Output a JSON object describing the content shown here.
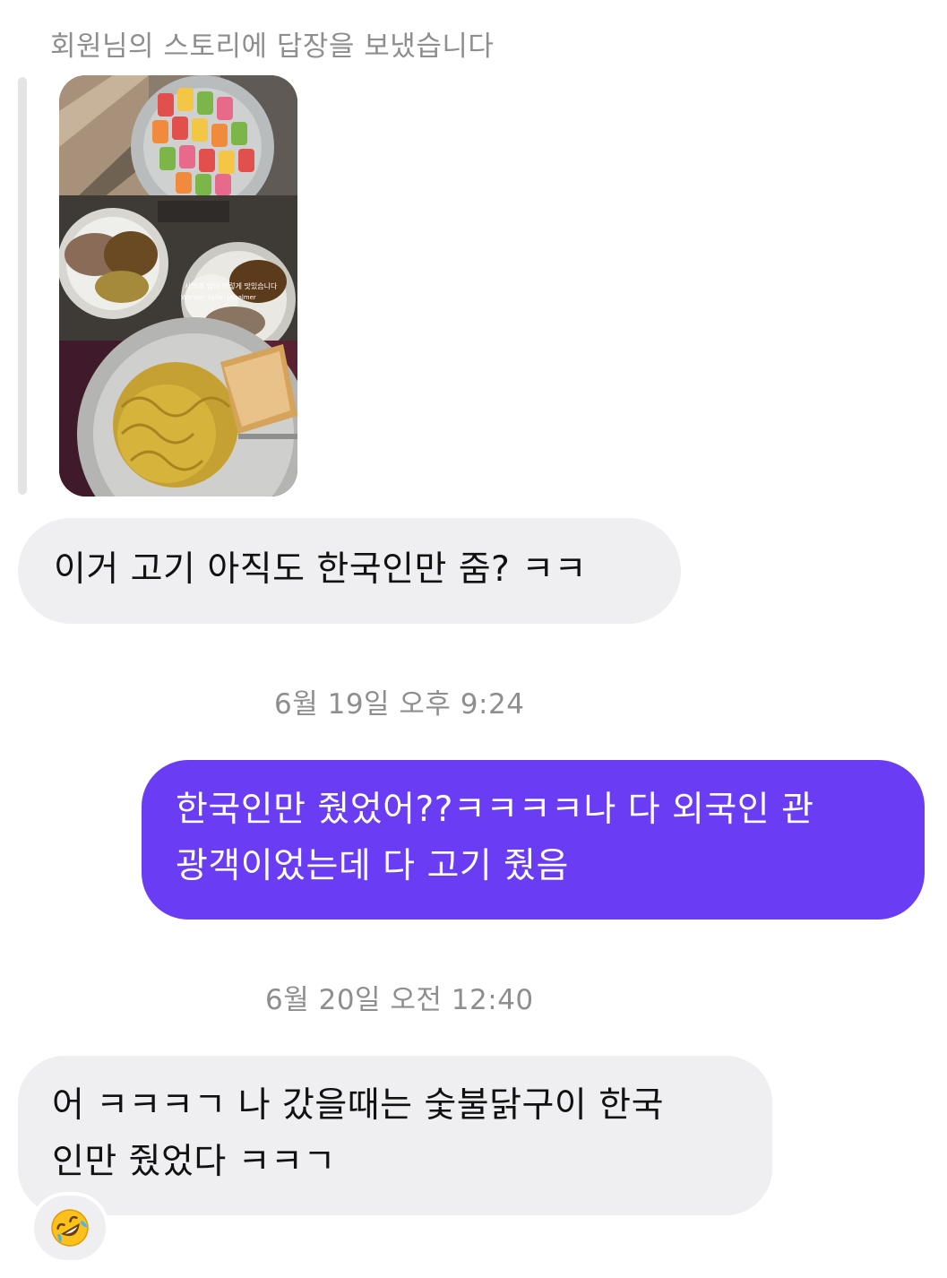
{
  "story_reply": {
    "label": "회원님의 스토리에 답장을 보냈습니다",
    "photo_caption": "사막의 밤이 이렇게 맛있습니다",
    "photo_location": "Wonder Safari Jaisalmer"
  },
  "messages": [
    {
      "sender": "them",
      "lines": [
        "이거 고기 아직도 한국인만 줌? ㅋㅋ"
      ]
    },
    {
      "timestamp": "6월 19일 오후 9:24"
    },
    {
      "sender": "me",
      "lines": [
        "한국인만 줬었어??ㅋㅋㅋㅋ나 다 외국인 관",
        "광객이었는데 다 고기 줬음"
      ]
    },
    {
      "timestamp": "6월 20일 오전 12:40"
    },
    {
      "sender": "them",
      "lines": [
        "어 ㅋㅋㅋㄱ 나 갔을때는 숯불닭구이 한국",
        "인만 줬었다 ㅋㅋㄱ"
      ],
      "reaction": "rolling-on-floor-laughing-emoji"
    }
  ],
  "colors": {
    "outgoing_bubble": "#6a3df5",
    "incoming_bubble": "#efeff1",
    "meta_text": "#8e8e8e"
  }
}
